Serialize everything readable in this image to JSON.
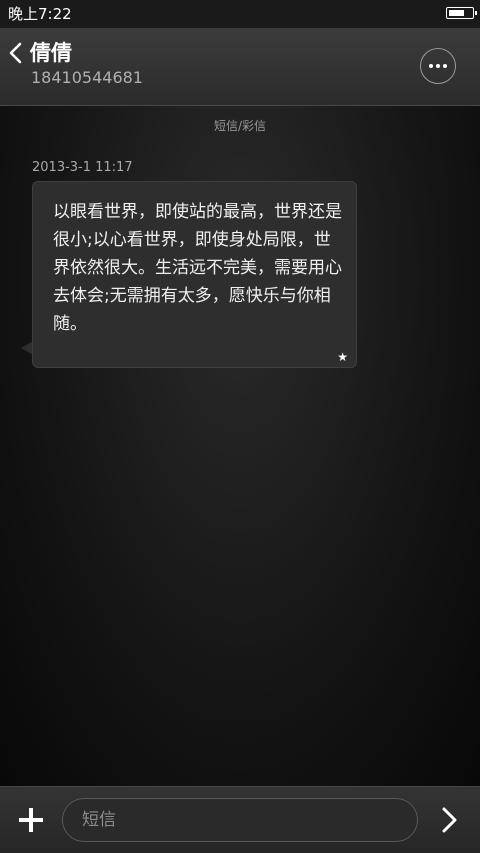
{
  "status_bar": {
    "time": "晚上7:22",
    "battery_level": 0.7
  },
  "header": {
    "back_icon": "chevron-left-icon",
    "contact_name": "倩倩",
    "contact_number": "18410544681",
    "more_icon": "more-dots-icon"
  },
  "conversation": {
    "channel_label": "短信/彩信",
    "messages": [
      {
        "timestamp": "2013-3-1 11:17",
        "text": "以眼看世界，即使站的最高，世界还是很小;以心看世界，即使身处局限，世界依然很大。生活远不完美，需要用心去体会;无需拥有太多，愿快乐与你相随。",
        "starred": true,
        "star_glyph": "★"
      }
    ]
  },
  "composer": {
    "add_icon": "plus-icon",
    "input_value": "",
    "input_placeholder": "短信",
    "send_icon": "chevron-right-icon"
  },
  "colors": {
    "background": "#0b0b0b",
    "header_bg": "#333333",
    "bubble_bg": "#2e2e2e",
    "text_primary": "#ffffff",
    "text_secondary": "#a9a9a9"
  }
}
